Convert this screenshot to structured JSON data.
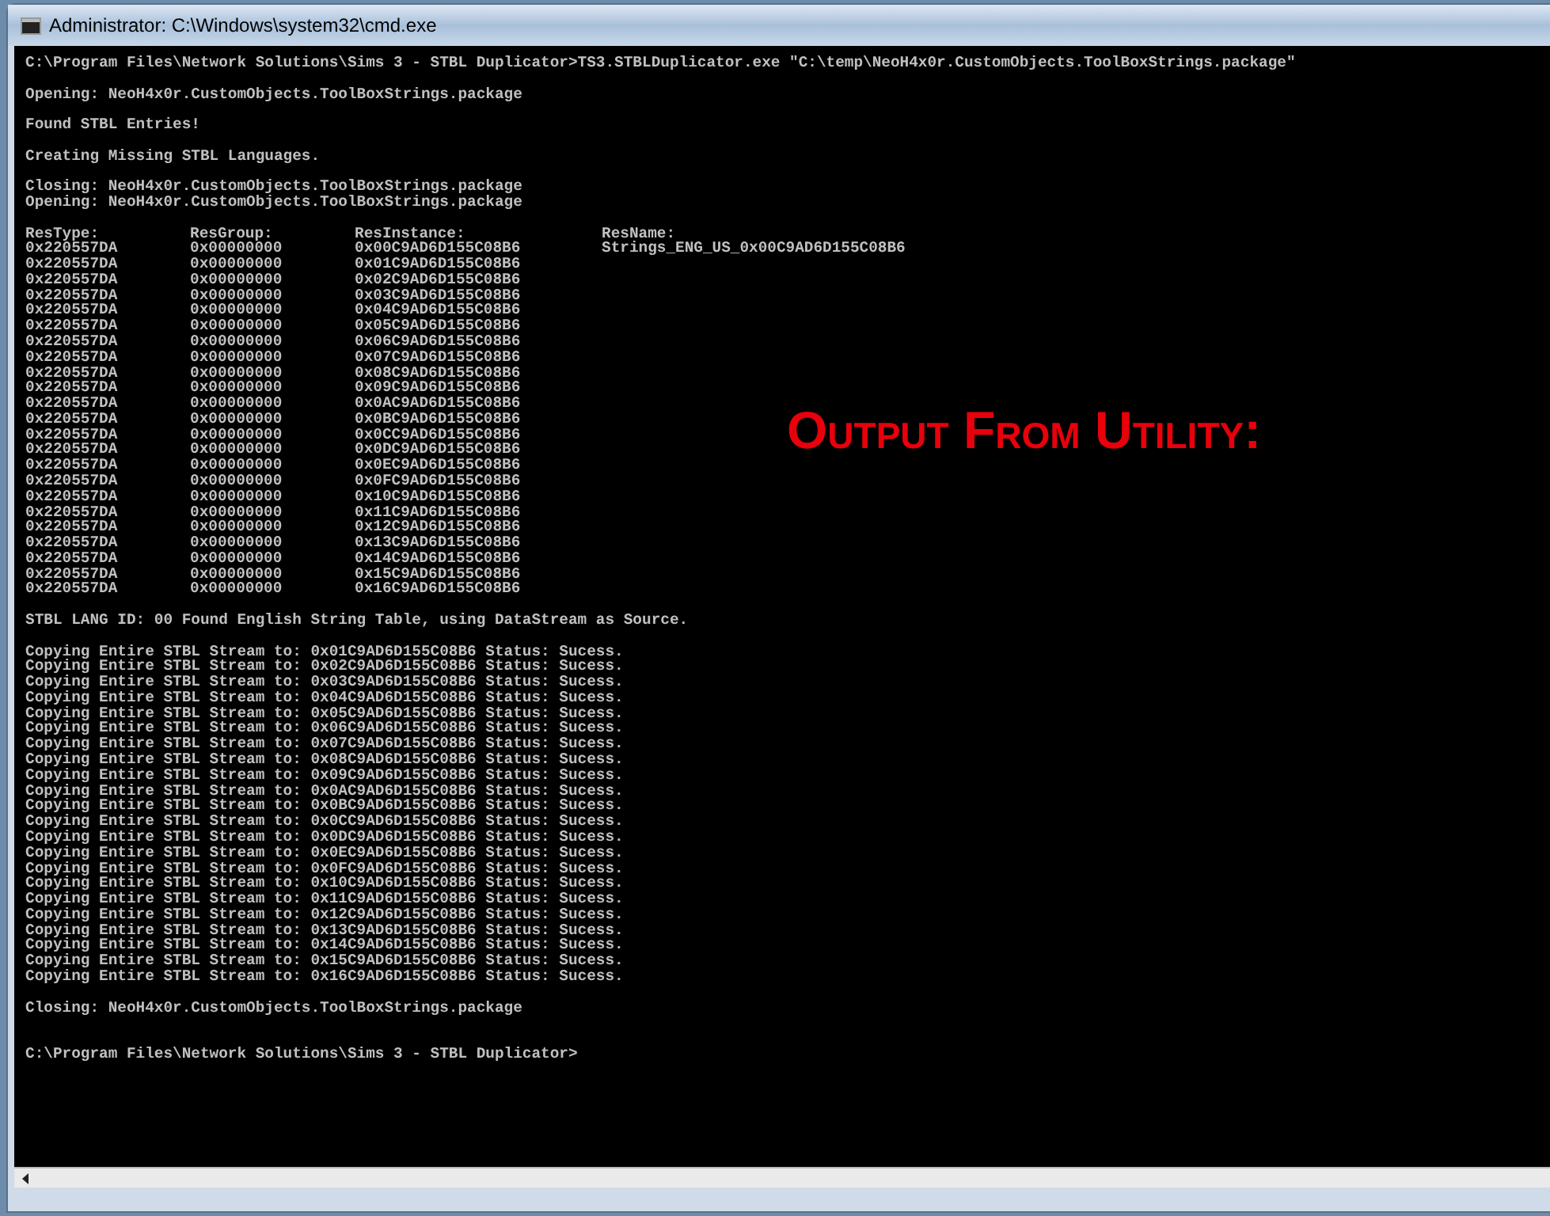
{
  "window": {
    "title": "Administrator: C:\\Windows\\system32\\cmd.exe"
  },
  "console": {
    "sections": [
      {
        "kind": "lines",
        "lines": [
          "C:\\Program Files\\Network Solutions\\Sims 3 - STBL Duplicator>TS3.STBLDuplicator.exe \"C:\\temp\\NeoH4x0r.CustomObjects.ToolBoxStrings.package\""
        ]
      },
      {
        "kind": "lines",
        "lines": [
          "Opening: NeoH4x0r.CustomObjects.ToolBoxStrings.package"
        ]
      },
      {
        "kind": "lines",
        "lines": [
          "Found STBL Entries!"
        ]
      },
      {
        "kind": "lines",
        "lines": [
          "Creating Missing STBL Languages."
        ]
      },
      {
        "kind": "lines",
        "lines": [
          "Closing: NeoH4x0r.CustomObjects.ToolBoxStrings.package",
          "Opening: NeoH4x0r.CustomObjects.ToolBoxStrings.package"
        ]
      },
      {
        "kind": "table",
        "columns": [
          "ResType:",
          "ResGroup:",
          "ResInstance:",
          "ResName:"
        ],
        "rows": [
          [
            "0x220557DA",
            "0x00000000",
            "0x00C9AD6D155C08B6",
            "Strings_ENG_US_0x00C9AD6D155C08B6"
          ],
          [
            "0x220557DA",
            "0x00000000",
            "0x01C9AD6D155C08B6"
          ],
          [
            "0x220557DA",
            "0x00000000",
            "0x02C9AD6D155C08B6"
          ],
          [
            "0x220557DA",
            "0x00000000",
            "0x03C9AD6D155C08B6"
          ],
          [
            "0x220557DA",
            "0x00000000",
            "0x04C9AD6D155C08B6"
          ],
          [
            "0x220557DA",
            "0x00000000",
            "0x05C9AD6D155C08B6"
          ],
          [
            "0x220557DA",
            "0x00000000",
            "0x06C9AD6D155C08B6"
          ],
          [
            "0x220557DA",
            "0x00000000",
            "0x07C9AD6D155C08B6"
          ],
          [
            "0x220557DA",
            "0x00000000",
            "0x08C9AD6D155C08B6"
          ],
          [
            "0x220557DA",
            "0x00000000",
            "0x09C9AD6D155C08B6"
          ],
          [
            "0x220557DA",
            "0x00000000",
            "0x0AC9AD6D155C08B6"
          ],
          [
            "0x220557DA",
            "0x00000000",
            "0x0BC9AD6D155C08B6"
          ],
          [
            "0x220557DA",
            "0x00000000",
            "0x0CC9AD6D155C08B6"
          ],
          [
            "0x220557DA",
            "0x00000000",
            "0x0DC9AD6D155C08B6"
          ],
          [
            "0x220557DA",
            "0x00000000",
            "0x0EC9AD6D155C08B6"
          ],
          [
            "0x220557DA",
            "0x00000000",
            "0x0FC9AD6D155C08B6"
          ],
          [
            "0x220557DA",
            "0x00000000",
            "0x10C9AD6D155C08B6"
          ],
          [
            "0x220557DA",
            "0x00000000",
            "0x11C9AD6D155C08B6"
          ],
          [
            "0x220557DA",
            "0x00000000",
            "0x12C9AD6D155C08B6"
          ],
          [
            "0x220557DA",
            "0x00000000",
            "0x13C9AD6D155C08B6"
          ],
          [
            "0x220557DA",
            "0x00000000",
            "0x14C9AD6D155C08B6"
          ],
          [
            "0x220557DA",
            "0x00000000",
            "0x15C9AD6D155C08B6"
          ],
          [
            "0x220557DA",
            "0x00000000",
            "0x16C9AD6D155C08B6"
          ]
        ]
      },
      {
        "kind": "lines",
        "lines": [
          "STBL LANG ID: 00 Found English String Table, using DataStream as Source."
        ]
      },
      {
        "kind": "lines",
        "lines": [
          "Copying Entire STBL Stream to: 0x01C9AD6D155C08B6 Status: Sucess.",
          "Copying Entire STBL Stream to: 0x02C9AD6D155C08B6 Status: Sucess.",
          "Copying Entire STBL Stream to: 0x03C9AD6D155C08B6 Status: Sucess.",
          "Copying Entire STBL Stream to: 0x04C9AD6D155C08B6 Status: Sucess.",
          "Copying Entire STBL Stream to: 0x05C9AD6D155C08B6 Status: Sucess.",
          "Copying Entire STBL Stream to: 0x06C9AD6D155C08B6 Status: Sucess.",
          "Copying Entire STBL Stream to: 0x07C9AD6D155C08B6 Status: Sucess.",
          "Copying Entire STBL Stream to: 0x08C9AD6D155C08B6 Status: Sucess.",
          "Copying Entire STBL Stream to: 0x09C9AD6D155C08B6 Status: Sucess.",
          "Copying Entire STBL Stream to: 0x0AC9AD6D155C08B6 Status: Sucess.",
          "Copying Entire STBL Stream to: 0x0BC9AD6D155C08B6 Status: Sucess.",
          "Copying Entire STBL Stream to: 0x0CC9AD6D155C08B6 Status: Sucess.",
          "Copying Entire STBL Stream to: 0x0DC9AD6D155C08B6 Status: Sucess.",
          "Copying Entire STBL Stream to: 0x0EC9AD6D155C08B6 Status: Sucess.",
          "Copying Entire STBL Stream to: 0x0FC9AD6D155C08B6 Status: Sucess.",
          "Copying Entire STBL Stream to: 0x10C9AD6D155C08B6 Status: Sucess.",
          "Copying Entire STBL Stream to: 0x11C9AD6D155C08B6 Status: Sucess.",
          "Copying Entire STBL Stream to: 0x12C9AD6D155C08B6 Status: Sucess.",
          "Copying Entire STBL Stream to: 0x13C9AD6D155C08B6 Status: Sucess.",
          "Copying Entire STBL Stream to: 0x14C9AD6D155C08B6 Status: Sucess.",
          "Copying Entire STBL Stream to: 0x15C9AD6D155C08B6 Status: Sucess.",
          "Copying Entire STBL Stream to: 0x16C9AD6D155C08B6 Status: Sucess."
        ]
      },
      {
        "kind": "lines",
        "lines": [
          "Closing: NeoH4x0r.CustomObjects.ToolBoxStrings.package"
        ]
      },
      {
        "kind": "prompt",
        "lines": [
          "C:\\Program Files\\Network Solutions\\Sims 3 - STBL Duplicator>"
        ]
      }
    ]
  },
  "annotation": {
    "text": "Output From Utility:"
  }
}
